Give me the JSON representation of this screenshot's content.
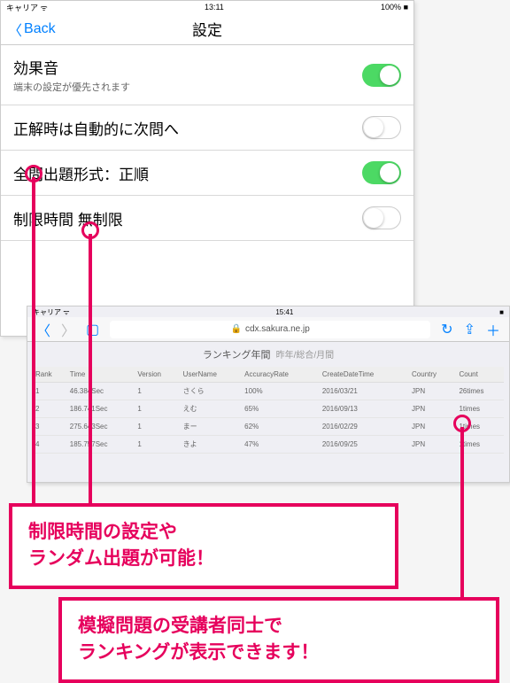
{
  "settings": {
    "status": {
      "carrier": "キャリア",
      "time": "13:11",
      "battery": "100%"
    },
    "nav": {
      "back": "Back",
      "title": "設定"
    },
    "rows": [
      {
        "label": "効果音",
        "sub": "端末の設定が優先されます",
        "on": true
      },
      {
        "label": "正解時は自動的に次問へ",
        "sub": "",
        "on": false
      },
      {
        "label": "全問出題形式：正順",
        "sub": "",
        "on": true
      },
      {
        "label": "制限時間 無制限",
        "sub": "",
        "on": false
      }
    ]
  },
  "browser": {
    "status": {
      "carrier": "キャリア",
      "time": "15:41"
    },
    "url": "cdx.sakura.ne.jp",
    "ranking_title": "ランキング年間",
    "ranking_sub": "昨年/総合/月間",
    "cols": [
      "Rank",
      "Time",
      "Version",
      "UserName",
      "AccuracyRate",
      "CreateDateTime",
      "Country",
      "Count"
    ],
    "rows": [
      [
        "1",
        "46.384Sec",
        "1",
        "さくら",
        "100%",
        "2016/03/21",
        "JPN",
        "26times"
      ],
      [
        "2",
        "186.741Sec",
        "1",
        "えむ",
        "65%",
        "2016/09/13",
        "JPN",
        "1times"
      ],
      [
        "3",
        "275.643Sec",
        "1",
        "まー",
        "62%",
        "2016/02/29",
        "JPN",
        "1times"
      ],
      [
        "4",
        "185.757Sec",
        "1",
        "きよ",
        "47%",
        "2016/09/25",
        "JPN",
        "1times"
      ]
    ]
  },
  "callouts": {
    "c1a": "制限時間の設定や",
    "c1b": "ランダム出題が可能！",
    "c2a": "模擬問題の受講者同士で",
    "c2b": "ランキングが表示できます！"
  }
}
